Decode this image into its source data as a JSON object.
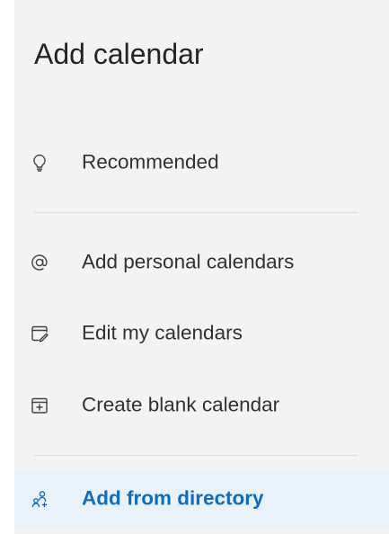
{
  "panel": {
    "title": "Add calendar"
  },
  "nav": {
    "items": [
      {
        "label": "Recommended",
        "icon": "lightbulb-icon",
        "selected": false
      },
      {
        "label": "Add personal calendars",
        "icon": "at-sign-icon",
        "selected": false
      },
      {
        "label": "Edit my calendars",
        "icon": "calendar-edit-icon",
        "selected": false
      },
      {
        "label": "Create blank calendar",
        "icon": "calendar-add-icon",
        "selected": false
      },
      {
        "label": "Add from directory",
        "icon": "people-search-icon",
        "selected": true
      }
    ]
  },
  "colors": {
    "panel_background": "#f3f3f3",
    "selected_background": "#e9f1fb",
    "accent": "#0f6cbd",
    "text": "#323130",
    "divider": "#dedede"
  }
}
